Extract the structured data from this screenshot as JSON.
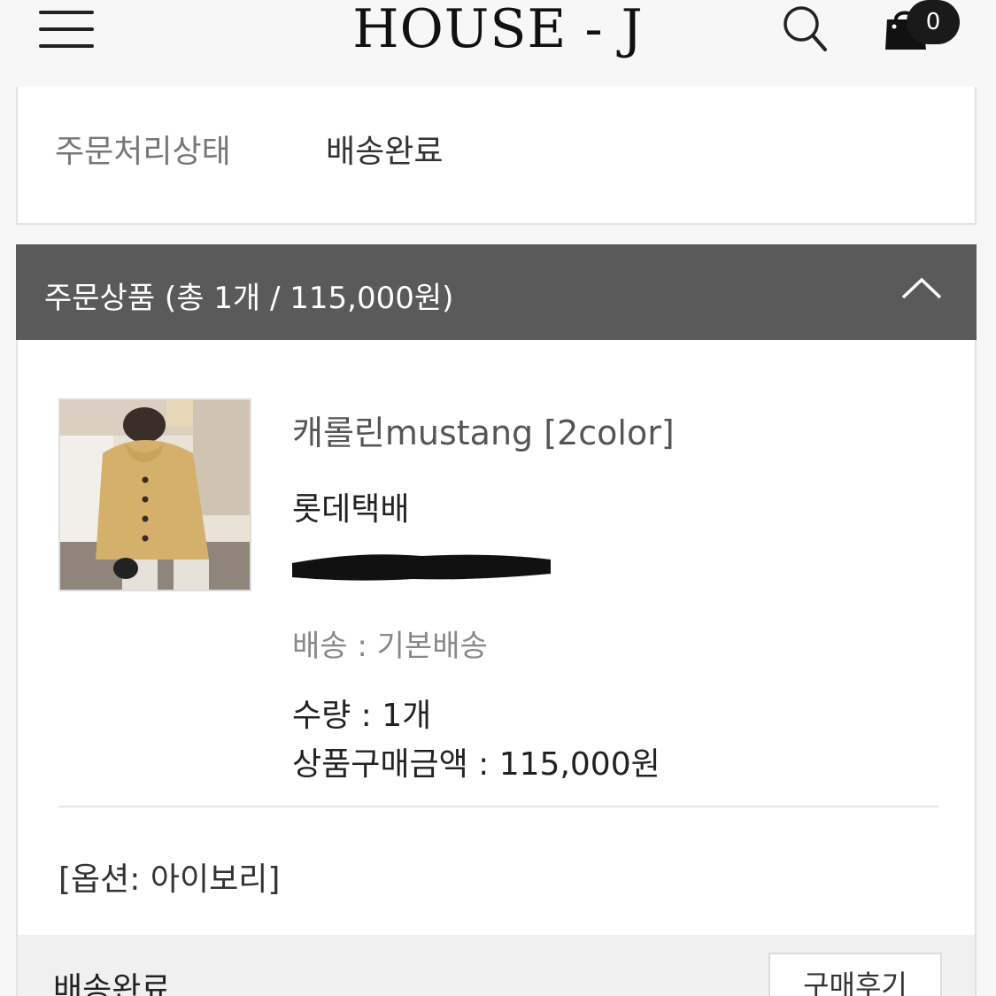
{
  "header": {
    "brand": "HOUSE - J",
    "cart_count": "0",
    "icons": [
      "hamburger-menu-icon",
      "search-icon",
      "cart-icon"
    ]
  },
  "status": {
    "label": "주문처리상태",
    "value": "배송완료"
  },
  "order_section": {
    "title": "주문상품 (총 1개 / 115,000원)"
  },
  "product": {
    "name": "캐롤린mustang [2color]",
    "courier": "롯데택배",
    "shipping": "배송 : 기본배송",
    "quantity": "수량 : 1개",
    "price": "상품구매금액 : 115,000원",
    "option": "[옵션: 아이보리]"
  },
  "footer": {
    "status": "배송완료",
    "review_button": "구매후기"
  },
  "colors": {
    "header_bg": "#f7f7f7",
    "section_bar": "#5a5a5a",
    "badge": "#1a1a1a"
  }
}
